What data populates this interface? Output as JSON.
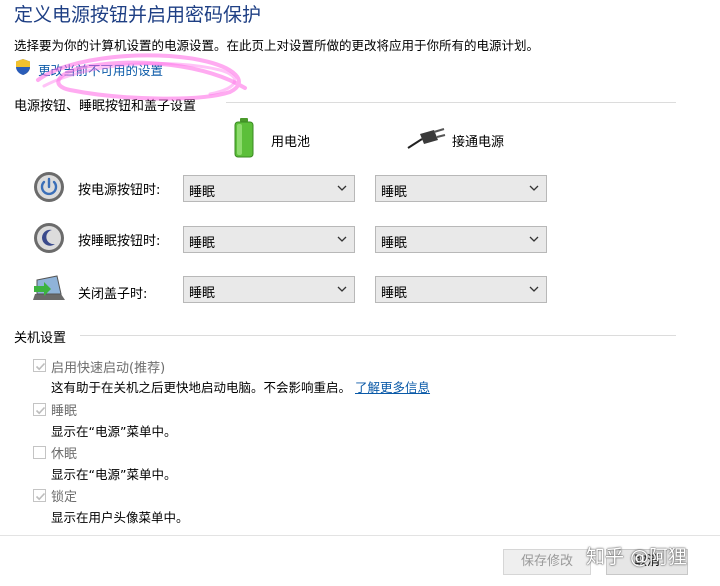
{
  "header": {
    "title": "定义电源按钮并启用密码保护",
    "description": "选择要为你的计算机设置的电源设置。在此页上对设置所做的更改将应用于你所有的电源计划。",
    "unavailable_link": "更改当前不可用的设置"
  },
  "power_section": {
    "heading": "电源按钮、睡眠按钮和盖子设置",
    "columns": [
      "用电池",
      "接通电源"
    ],
    "rows": [
      {
        "label": "按电源按钮时:",
        "icon": "power-button-icon",
        "battery": "睡眠",
        "plugged": "睡眠"
      },
      {
        "label": "按睡眠按钮时:",
        "icon": "sleep-button-icon",
        "battery": "睡眠",
        "plugged": "睡眠"
      },
      {
        "label": "关闭盖子时:",
        "icon": "laptop-lid-icon",
        "battery": "睡眠",
        "plugged": "睡眠"
      }
    ]
  },
  "shutdown_section": {
    "heading": "关机设置",
    "options": [
      {
        "label": "启用快速启动(推荐)",
        "checked": true,
        "desc": "这有助于在关机之后更快地启动电脑。不会影响重启。",
        "link": "了解更多信息"
      },
      {
        "label": "睡眠",
        "checked": true,
        "desc": "显示在“电源”菜单中。"
      },
      {
        "label": "休眠",
        "checked": false,
        "desc": "显示在“电源”菜单中。"
      },
      {
        "label": "锁定",
        "checked": true,
        "desc": "显示在用户头像菜单中。"
      }
    ]
  },
  "footer": {
    "save_label": "保存修改",
    "cancel_label": "取消",
    "watermark": "知乎 @阿狸"
  },
  "colors": {
    "title": "#1e3f84",
    "link": "#0b5aa8",
    "scribble": "#ff66e6"
  }
}
